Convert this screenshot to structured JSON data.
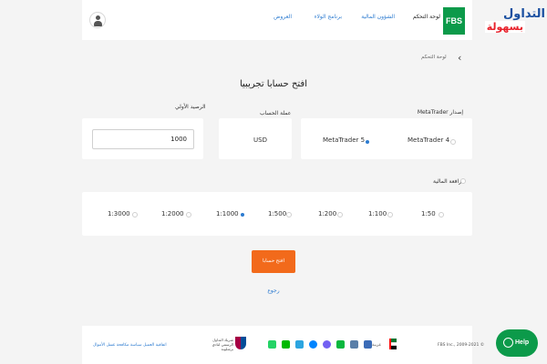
{
  "header": {
    "logo_text": "FBS",
    "watermark_top": "التداول",
    "watermark_bottom": "بسهولة",
    "nav": [
      {
        "label": "لوحة التحكم",
        "active": true
      },
      {
        "label": "الشؤون المالية",
        "active": false
      },
      {
        "label": "برنامج الولاء",
        "active": false
      },
      {
        "label": "العروض",
        "active": false
      }
    ]
  },
  "breadcrumb": {
    "label": "لوحة التحكم"
  },
  "page_title": "افتح حسابا تجريبيا",
  "metatrader": {
    "label": "إصدار MetaTrader",
    "options": [
      {
        "label": "MetaTrader 4",
        "selected": false
      },
      {
        "label": "MetaTrader 5",
        "selected": true
      }
    ]
  },
  "currency": {
    "label": "عملة الحساب",
    "value": "USD"
  },
  "balance": {
    "label": "الرصيد الأولي",
    "value": "1000"
  },
  "leverage": {
    "label": "الرافعة المالية",
    "options": [
      {
        "label": "1:50",
        "selected": false
      },
      {
        "label": "1:100",
        "selected": false
      },
      {
        "label": "1:200",
        "selected": false
      },
      {
        "label": "1:500",
        "selected": false
      },
      {
        "label": "1:1000",
        "selected": true
      },
      {
        "label": "1:2000",
        "selected": false
      },
      {
        "label": "1:3000",
        "selected": false
      }
    ]
  },
  "actions": {
    "open_label": "افتح حسابا",
    "back_label": "رجوع"
  },
  "footer": {
    "copyright": "FBS Inc., 2009-2021 ©",
    "language": "عربية",
    "sponsor_text": "شريك التداول الرسمي لنادي برشلونة",
    "links": "اتفاقية العميل    سياسة مكافحة غسل الأموال",
    "social_icons": [
      {
        "name": "whatsapp-icon",
        "color": "#25d366"
      },
      {
        "name": "line-icon",
        "color": "#00b900"
      },
      {
        "name": "telegram-icon",
        "color": "#2ca5e0"
      },
      {
        "name": "messenger-icon",
        "color": "#0084ff"
      },
      {
        "name": "viber-icon",
        "color": "#7360f2"
      },
      {
        "name": "wechat-icon",
        "color": "#09b83e"
      },
      {
        "name": "email-icon",
        "color": "#5a7fa8"
      },
      {
        "name": "chat-icon",
        "color": "#3b6cb7"
      }
    ]
  },
  "help": {
    "label": "Help"
  },
  "colors": {
    "accent": "#2c7bd0",
    "brand_green": "#0c9a4a",
    "primary_button": "#f26a1b"
  }
}
